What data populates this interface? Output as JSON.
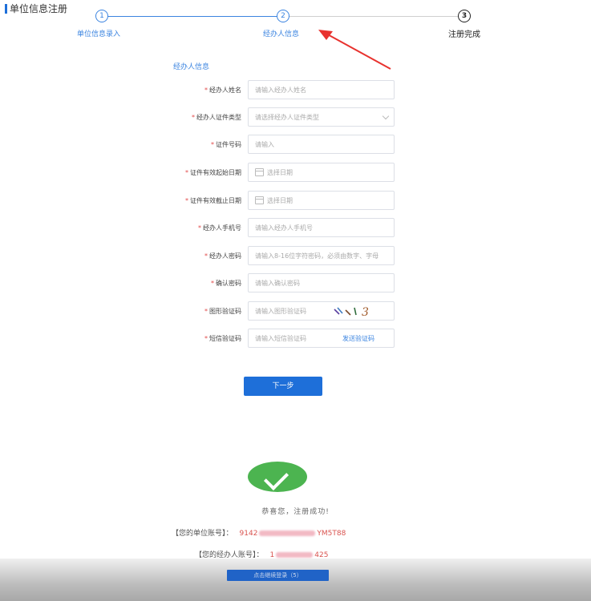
{
  "page": {
    "title": "单位信息注册"
  },
  "steps": [
    {
      "num": "1",
      "label": "单位信息录入"
    },
    {
      "num": "2",
      "label": "经办人信息"
    },
    {
      "num": "3",
      "label": "注册完成"
    }
  ],
  "section_title": "经办人信息",
  "form": {
    "name": {
      "label": "经办人姓名",
      "placeholder": "请输入经办人姓名"
    },
    "id_type": {
      "label": "经办人证件类型",
      "placeholder": "请选择经办人证件类型"
    },
    "id_number": {
      "label": "证件号码",
      "placeholder": "请输入"
    },
    "valid_start": {
      "label": "证件有效起始日期",
      "placeholder": "选择日期"
    },
    "valid_end": {
      "label": "证件有效截止日期",
      "placeholder": "选择日期"
    },
    "phone": {
      "label": "经办人手机号",
      "placeholder": "请输入经办人手机号"
    },
    "password": {
      "label": "经办人密码",
      "placeholder": "请输入8-16位字符密码，必须由数字、字母"
    },
    "confirm_password": {
      "label": "确认密码",
      "placeholder": "请输入确认密码"
    },
    "captcha": {
      "label": "图形验证码",
      "placeholder": "请输入图形验证码"
    },
    "sms_code": {
      "label": "短信验证码",
      "placeholder": "请输入短信验证码",
      "send_label": "发送验证码"
    }
  },
  "next_button": "下一步",
  "success": {
    "message": "恭喜您，注册成功!",
    "unit_account_label": "【您的单位账号】：",
    "unit_account_prefix": "9142",
    "unit_account_suffix": "YM5T88",
    "agent_account_label": "【您的经办人账号】：",
    "agent_account_prefix": "1",
    "agent_account_suffix": "425",
    "back_button": "点击继续登录（5）"
  },
  "colors": {
    "primary": "#1e6fd9",
    "required": "#e24b4b",
    "success": "#4cb450",
    "arrow": "#e8322e"
  }
}
